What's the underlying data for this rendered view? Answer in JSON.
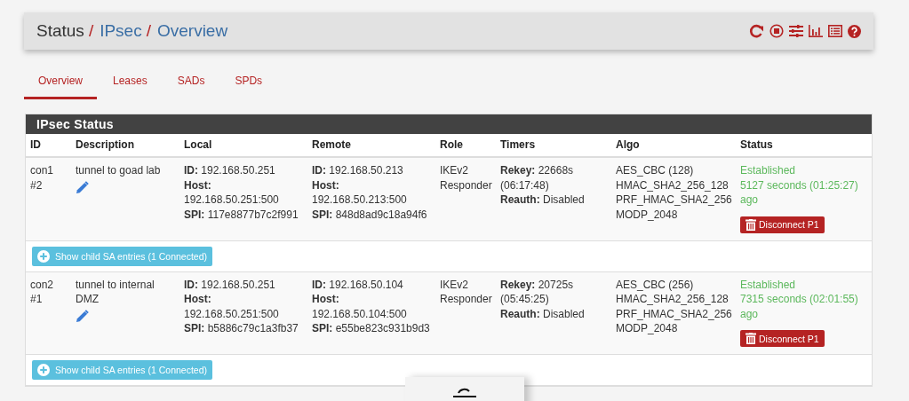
{
  "breadcrumb": [
    {
      "label": "Status",
      "link": false,
      "separator": "/"
    },
    {
      "label": "IPsec",
      "link": true,
      "separator": "/"
    },
    {
      "label": "Overview",
      "link": true
    }
  ],
  "tabs": [
    {
      "label": "Overview",
      "selected": true
    },
    {
      "label": "Leases",
      "selected": false
    },
    {
      "label": "SADs",
      "selected": false
    },
    {
      "label": "SPDs",
      "selected": false
    }
  ],
  "panel": {
    "title": "IPsec Status",
    "columns": [
      "ID",
      "Description",
      "Local",
      "Remote",
      "Role",
      "Timers",
      "Algo",
      "Status"
    ],
    "rows": [
      {
        "id": [
          "con1",
          "#2"
        ],
        "description": "tunnel to goad lab",
        "local": [
          "**ID:** 192.168.50.251",
          "**Host:** 192.168.50.251:500",
          "**SPI:** 117e8877b7c2f991"
        ],
        "remote": [
          "**ID:** 192.168.50.213",
          "**Host:** 192.168.50.213:500",
          "**SPI:** 848d8ad9c18a94f6"
        ],
        "role": "IKEv2 Responder",
        "timers": [
          "**Rekey:** 22668s (06:17:48)",
          "**Reauth:** Disabled"
        ],
        "algo": [
          "AES_CBC (128)",
          "HMAC_SHA2_256_128",
          "PRF_HMAC_SHA2_256",
          "MODP_2048"
        ],
        "status": [
          "Established",
          "5127 seconds (01:25:27) ago"
        ],
        "action": "Disconnect P1",
        "child_button": "Show child SA entries (1 Connected)"
      },
      {
        "id": [
          "con2",
          "#1"
        ],
        "description": "tunnel to internal DMZ",
        "local": [
          "**ID:** 192.168.50.251",
          "**Host:** 192.168.50.251:500",
          "**SPI:** b5886c79c1a3fb37"
        ],
        "remote": [
          "**ID:** 192.168.50.104",
          "**Host:** 192.168.50.104:500",
          "**SPI:** e55be823c931b9d3"
        ],
        "role": "IKEv2 Responder",
        "timers": [
          "**Rekey:** 20725s (05:45:25)",
          "**Reauth:** Disabled"
        ],
        "algo": [
          "AES_CBC (256)",
          "HMAC_SHA2_256_128",
          "PRF_HMAC_SHA2_256",
          "MODP_2048"
        ],
        "status": [
          "Established",
          "7315 seconds (02:01:55) ago"
        ],
        "action": "Disconnect P1",
        "child_button": "Show child SA entries (1 Connected)"
      }
    ]
  }
}
